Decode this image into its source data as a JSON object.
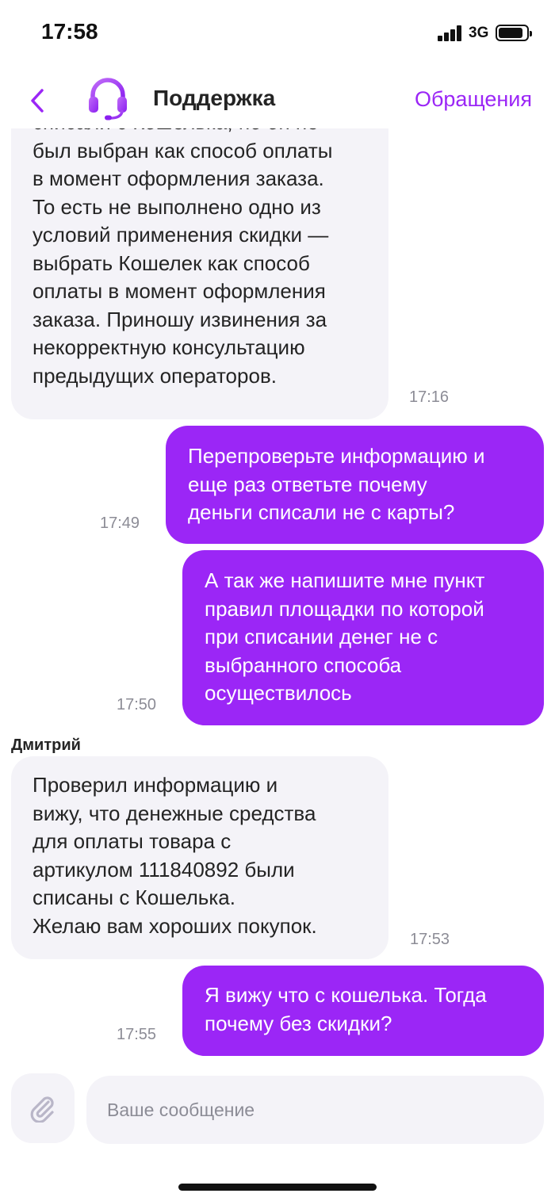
{
  "status_bar": {
    "time": "17:58",
    "network": "3G"
  },
  "header": {
    "title": "Поддержка",
    "link": "Обращения"
  },
  "messages": [
    {
      "text": "списали с Кошелька, но он не\nбыл выбран как способ оплаты\nв момент оформления заказа.\nТо есть не выполнено одно из\nусловий применения скидки —\nвыбрать Кошелек как способ\nоплаты в момент оформления\nзаказа. Приношу извинения за\nнекорректную консультацию\nпредыдущих операторов.",
      "time": "17:16"
    },
    {
      "text": "Перепроверьте информацию и\nеще раз ответьте почему\nденьги списали не с карты?",
      "time": "17:49"
    },
    {
      "text": "А так же напишите мне пункт\nправил площадки по которой\nпри списании денег не с\nвыбранного способа\nосуществилось",
      "time": "17:50"
    },
    {
      "sender": "Дмитрий",
      "text": "Проверил информацию и\nвижу, что денежные средства\nдля оплаты товара с\nартикулом 111840892 были\nсписаны с Кошелька.\nЖелаю вам хороших покупок.",
      "time": "17:53"
    },
    {
      "text": "Я вижу что с кошелька. Тогда\nпочему без скидки?",
      "time": "17:55"
    }
  ],
  "composer": {
    "placeholder": "Ваше сообщение"
  },
  "colors": {
    "accent": "#9b26f6",
    "incoming_bubble": "#f4f3f8",
    "time_text": "#8c8c96"
  },
  "icons": {
    "back": "chevron-left-icon",
    "avatar": "headset-icon",
    "attach": "paperclip-icon"
  }
}
